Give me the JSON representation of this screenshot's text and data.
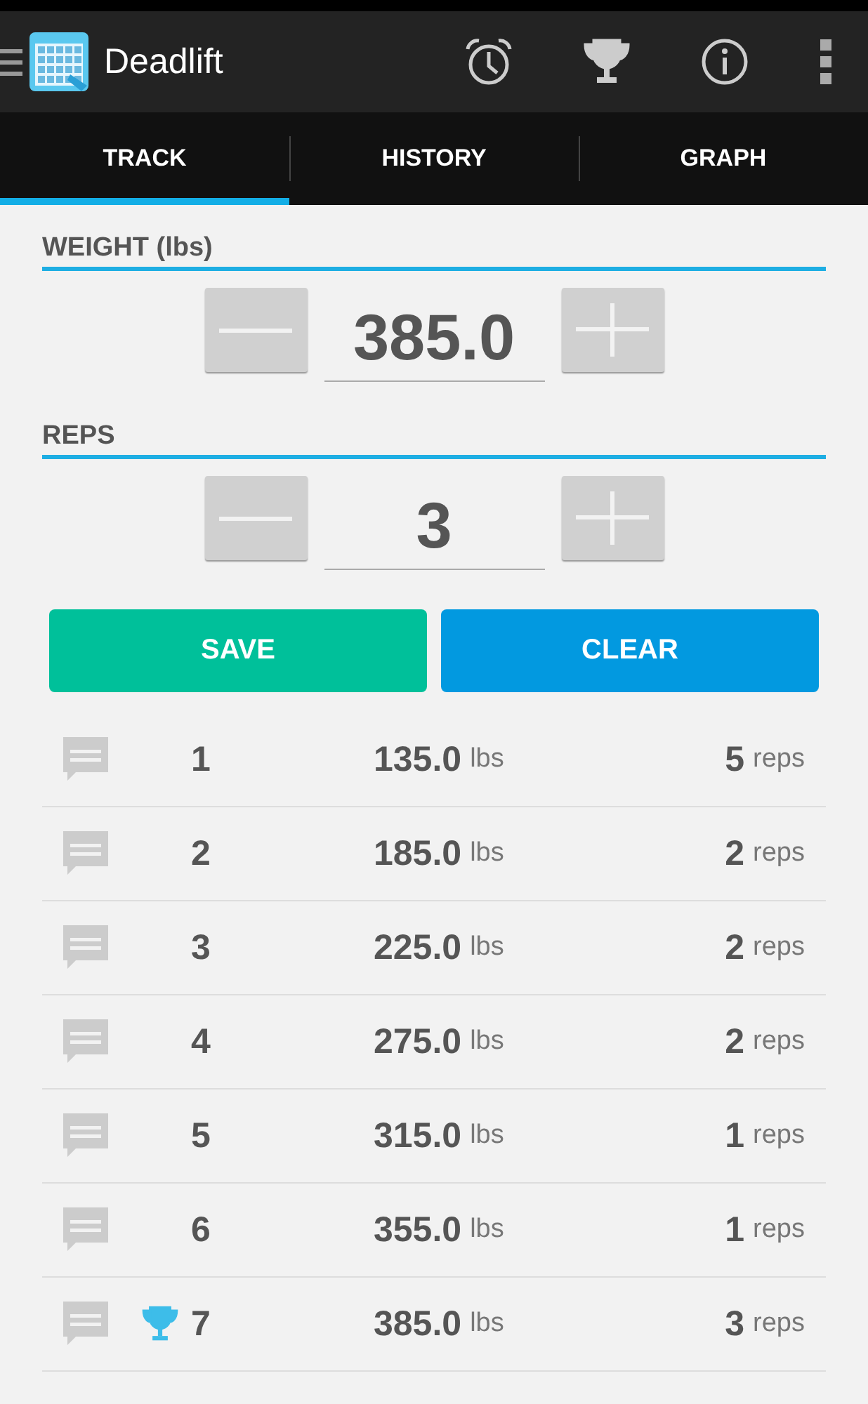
{
  "app_bar": {
    "title": "Deadlift"
  },
  "tabs": [
    {
      "label": "TRACK",
      "selected": true
    },
    {
      "label": "HISTORY",
      "selected": false
    },
    {
      "label": "GRAPH",
      "selected": false
    }
  ],
  "weight": {
    "label": "WEIGHT (lbs)",
    "value": "385.0"
  },
  "reps": {
    "label": "REPS",
    "value": "3"
  },
  "buttons": [
    {
      "label": "SAVE",
      "kind": "save"
    },
    {
      "label": "CLEAR",
      "kind": "clear"
    }
  ],
  "sets": [
    {
      "number": "1",
      "weight": "135.0",
      "weight_unit": "lbs",
      "reps": "5",
      "reps_unit": "reps",
      "record": false
    },
    {
      "number": "2",
      "weight": "185.0",
      "weight_unit": "lbs",
      "reps": "2",
      "reps_unit": "reps",
      "record": false
    },
    {
      "number": "3",
      "weight": "225.0",
      "weight_unit": "lbs",
      "reps": "2",
      "reps_unit": "reps",
      "record": false
    },
    {
      "number": "4",
      "weight": "275.0",
      "weight_unit": "lbs",
      "reps": "2",
      "reps_unit": "reps",
      "record": false
    },
    {
      "number": "5",
      "weight": "315.0",
      "weight_unit": "lbs",
      "reps": "1",
      "reps_unit": "reps",
      "record": false
    },
    {
      "number": "6",
      "weight": "355.0",
      "weight_unit": "lbs",
      "reps": "1",
      "reps_unit": "reps",
      "record": false
    },
    {
      "number": "7",
      "weight": "385.0",
      "weight_unit": "lbs",
      "reps": "3",
      "reps_unit": "reps",
      "record": true
    }
  ]
}
